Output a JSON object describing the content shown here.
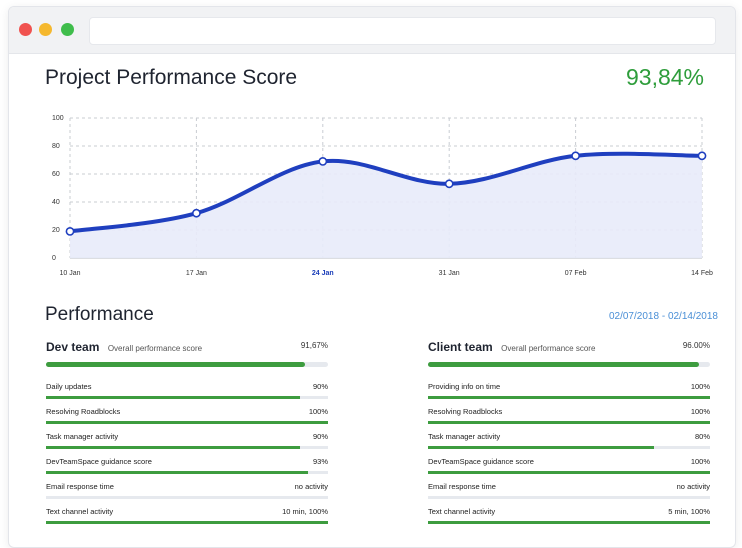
{
  "window": {
    "controls": [
      "close",
      "minimize",
      "maximize"
    ]
  },
  "header": {
    "title": "Project Performance Score",
    "score": "93,84%"
  },
  "colors": {
    "line": "#1f3fbf",
    "area": "#e8ebfa",
    "score": "#2e9d3b",
    "bar": "#3d9c3f",
    "date": "#4a8fd6"
  },
  "chart_data": {
    "type": "line",
    "x": [
      "10 Jan",
      "17 Jan",
      "24 Jan",
      "31 Jan",
      "07 Feb",
      "14 Feb"
    ],
    "series": [
      {
        "values": [
          19,
          32,
          69,
          53,
          73,
          73
        ]
      }
    ],
    "y_ticks": [
      0,
      20,
      40,
      60,
      80,
      100
    ],
    "ylim": [
      0,
      100
    ],
    "highlighted_x": "24 Jan",
    "grid": true
  },
  "performance": {
    "title": "Performance",
    "date_from": "02/07/2018",
    "date_sep": "-",
    "date_to": "02/14/2018",
    "teams": [
      {
        "name": "Dev team",
        "subtitle": "Overall performance score",
        "pct_text": "91,67%",
        "pct": 0.9167,
        "metrics": [
          {
            "label": "Daily updates",
            "value": "90%",
            "pct": 0.9
          },
          {
            "label": "Resolving Roadblocks",
            "value": "100%",
            "pct": 1.0
          },
          {
            "label": "Task manager activity",
            "value": "90%",
            "pct": 0.9
          },
          {
            "label": "DevTeamSpace guidance score",
            "value": "93%",
            "pct": 0.93
          },
          {
            "label": "Email response time",
            "value": "no activity",
            "pct": 0
          },
          {
            "label": "Text channel activity",
            "value": "10 min, 100%",
            "pct": 1.0
          }
        ]
      },
      {
        "name": "Client team",
        "subtitle": "Overall performance score",
        "pct_text": "96.00%",
        "pct": 0.96,
        "metrics": [
          {
            "label": "Providing info on time",
            "value": "100%",
            "pct": 1.0
          },
          {
            "label": "Resolving Roadblocks",
            "value": "100%",
            "pct": 1.0
          },
          {
            "label": "Task manager activity",
            "value": "80%",
            "pct": 0.8
          },
          {
            "label": "DevTeamSpace guidance score",
            "value": "100%",
            "pct": 1.0
          },
          {
            "label": "Email response time",
            "value": "no activity",
            "pct": 0
          },
          {
            "label": "Text channel activity",
            "value": "5 min, 100%",
            "pct": 1.0
          }
        ]
      }
    ]
  }
}
